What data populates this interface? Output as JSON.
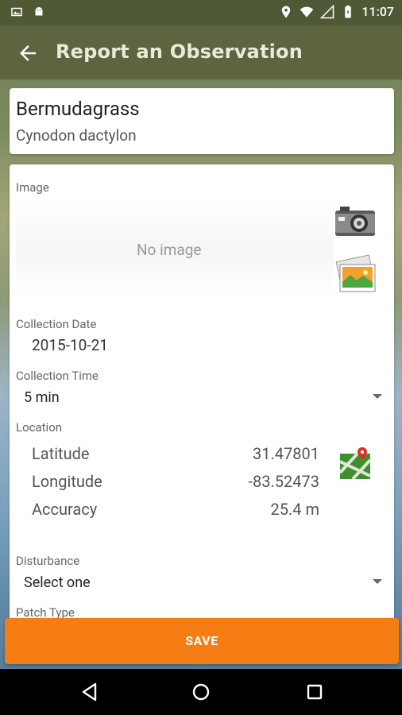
{
  "status_bar": {
    "time": "11:07",
    "left_icons": [
      "image-icon",
      "android-icon"
    ],
    "right_icons": [
      "location-icon",
      "wifi-icon",
      "signal-icon",
      "battery-icon"
    ]
  },
  "app_bar": {
    "title": "Report an Observation",
    "back_icon": "arrow-back-icon"
  },
  "species": {
    "common_name": "Bermudagrass",
    "scientific_name": "Cynodon dactylon"
  },
  "form": {
    "image_label": "Image",
    "no_image_text": "No image",
    "collection_date_label": "Collection Date",
    "collection_date_value": "2015-10-21",
    "collection_time_label": "Collection Time",
    "collection_time_value": "5 min",
    "location_label": "Location",
    "latitude_label": "Latitude",
    "latitude_value": "31.47801",
    "longitude_label": "Longitude",
    "longitude_value": "-83.52473",
    "accuracy_label": "Accuracy",
    "accuracy_value": "25.4 m",
    "disturbance_label": "Disturbance",
    "disturbance_value": "Select one",
    "patch_type_label": "Patch Type"
  },
  "actions": {
    "save_label": "SAVE"
  },
  "colors": {
    "status_bar": "#4f5936",
    "app_bar": "#5d6540",
    "save_button": "#f57d14"
  }
}
